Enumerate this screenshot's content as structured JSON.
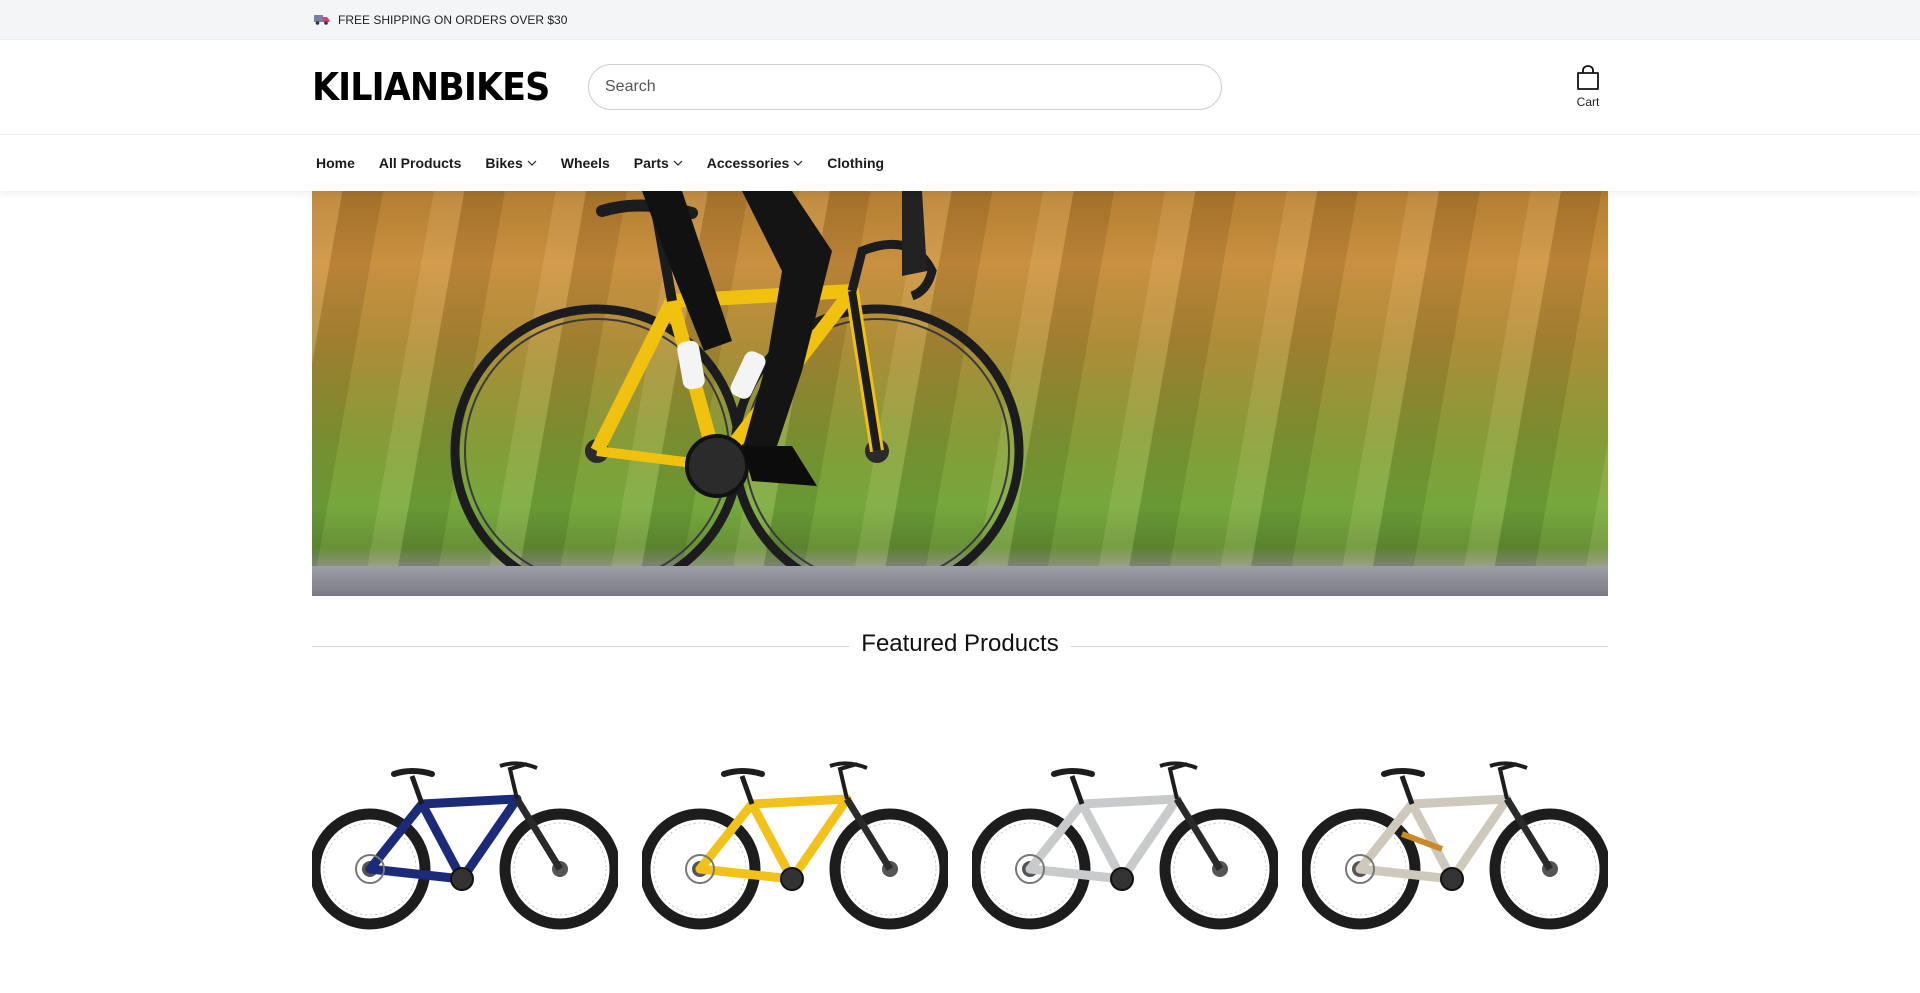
{
  "announcement": {
    "text": "FREE SHIPPING ON ORDERS OVER $30",
    "icon": "truck-icon"
  },
  "header": {
    "logo": "KILIANBIKES",
    "search": {
      "placeholder": "Search",
      "value": ""
    },
    "cart": {
      "label": "Cart",
      "icon": "bag-icon"
    }
  },
  "nav": {
    "items": [
      {
        "label": "Home",
        "dropdown": false
      },
      {
        "label": "All Products",
        "dropdown": false
      },
      {
        "label": "Bikes",
        "dropdown": true
      },
      {
        "label": "Wheels",
        "dropdown": false
      },
      {
        "label": "Parts",
        "dropdown": true
      },
      {
        "label": "Accessories",
        "dropdown": true
      },
      {
        "label": "Clothing",
        "dropdown": false
      }
    ]
  },
  "hero": {
    "image": "cyclist-on-yellow-road-bike"
  },
  "featured": {
    "title": "Featured Products"
  },
  "products": [
    {
      "image": "navy-blue-hardtail-mountain-bike",
      "frame_color": "#1c2a7a"
    },
    {
      "image": "yellow-hardtail-mountain-bike",
      "frame_color": "#f2c21a"
    },
    {
      "image": "silver-hardtail-mountain-bike",
      "frame_color": "#c8cacc"
    },
    {
      "image": "beige-full-suspension-mountain-bike",
      "frame_color": "#cfc8bd"
    }
  ],
  "colors": {
    "announcement_bg": "#f4f5f6",
    "text": "#111111",
    "border": "#cfcfcf"
  }
}
